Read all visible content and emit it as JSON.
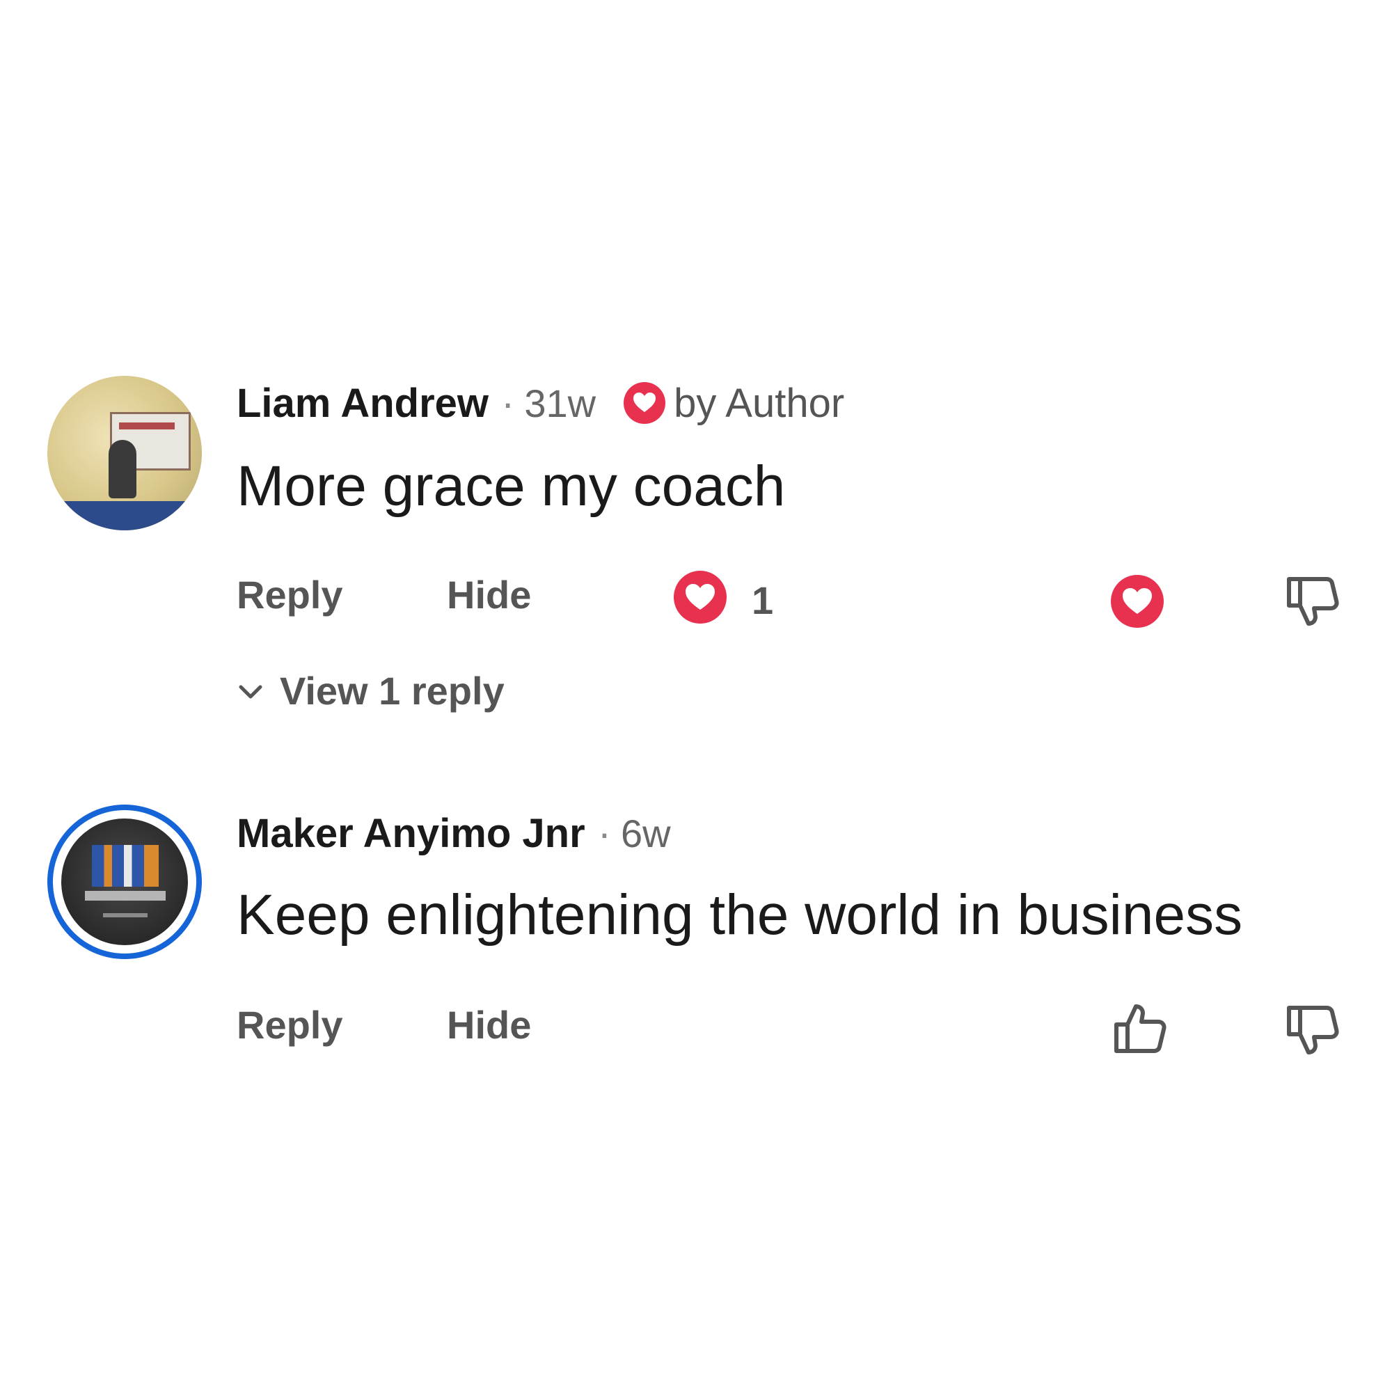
{
  "comments": [
    {
      "author": "Liam Andrew",
      "separator": "·",
      "time": "31w",
      "author_reaction_label": "by Author",
      "text": "More grace my coach",
      "actions": {
        "reply": "Reply",
        "hide": "Hide"
      },
      "reaction_count": "1",
      "view_replies": "View 1 reply",
      "reaction_icon": "heart-icon",
      "dislike_icon": "thumbs-down-icon"
    },
    {
      "author": "Maker Anyimo Jnr",
      "separator": "·",
      "time": "6w",
      "text": "Keep enlightening the world in business",
      "actions": {
        "reply": "Reply",
        "hide": "Hide"
      },
      "like_icon": "thumbs-up-icon",
      "dislike_icon": "thumbs-down-icon"
    }
  ],
  "colors": {
    "heart": "#e8304f",
    "avatar_ring": "#1565d8",
    "action_text": "#555555",
    "body_text": "#1a1a1a"
  }
}
